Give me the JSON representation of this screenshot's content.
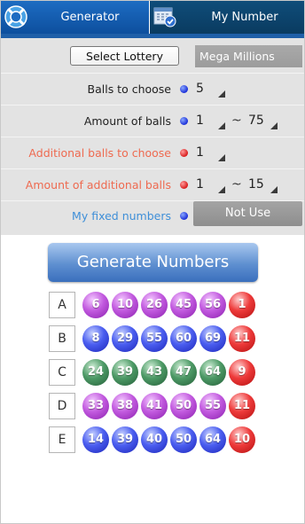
{
  "tabs": {
    "generator": {
      "label": "Generator",
      "icon": "lifebuoy-icon"
    },
    "my_number": {
      "label": "My Number",
      "icon": "calendar-check-icon"
    }
  },
  "settings": {
    "select_lottery_label": "Select Lottery",
    "lottery_name": "Mega Millions",
    "balls_to_choose": {
      "label": "Balls to choose",
      "value": "5"
    },
    "amount_of_balls": {
      "label": "Amount of balls",
      "min": "1",
      "separator": "~",
      "max": "75"
    },
    "additional_balls_to_choose": {
      "label": "Additional balls to choose",
      "value": "1"
    },
    "amount_of_additional_balls": {
      "label": "Amount of additional balls",
      "min": "1",
      "separator": "~",
      "max": "15"
    },
    "fixed_numbers": {
      "label": "My fixed numbers",
      "button": "Not Use"
    }
  },
  "generate_label": "Generate Numbers",
  "colors": {
    "purple": "#c25adf",
    "blue": "#4b5ef0",
    "green": "#4d9a66",
    "red": "#ee3a3a",
    "tab_active": "#1d6cc2"
  },
  "sets": [
    {
      "label": "A",
      "color": "purple",
      "numbers": [
        "6",
        "10",
        "26",
        "45",
        "56"
      ],
      "extra": "1"
    },
    {
      "label": "B",
      "color": "blue",
      "numbers": [
        "8",
        "29",
        "55",
        "60",
        "69"
      ],
      "extra": "11"
    },
    {
      "label": "C",
      "color": "green",
      "numbers": [
        "24",
        "39",
        "43",
        "47",
        "64"
      ],
      "extra": "9"
    },
    {
      "label": "D",
      "color": "purple",
      "numbers": [
        "33",
        "38",
        "41",
        "50",
        "55"
      ],
      "extra": "11"
    },
    {
      "label": "E",
      "color": "blue",
      "numbers": [
        "14",
        "39",
        "40",
        "50",
        "64"
      ],
      "extra": "10"
    }
  ]
}
